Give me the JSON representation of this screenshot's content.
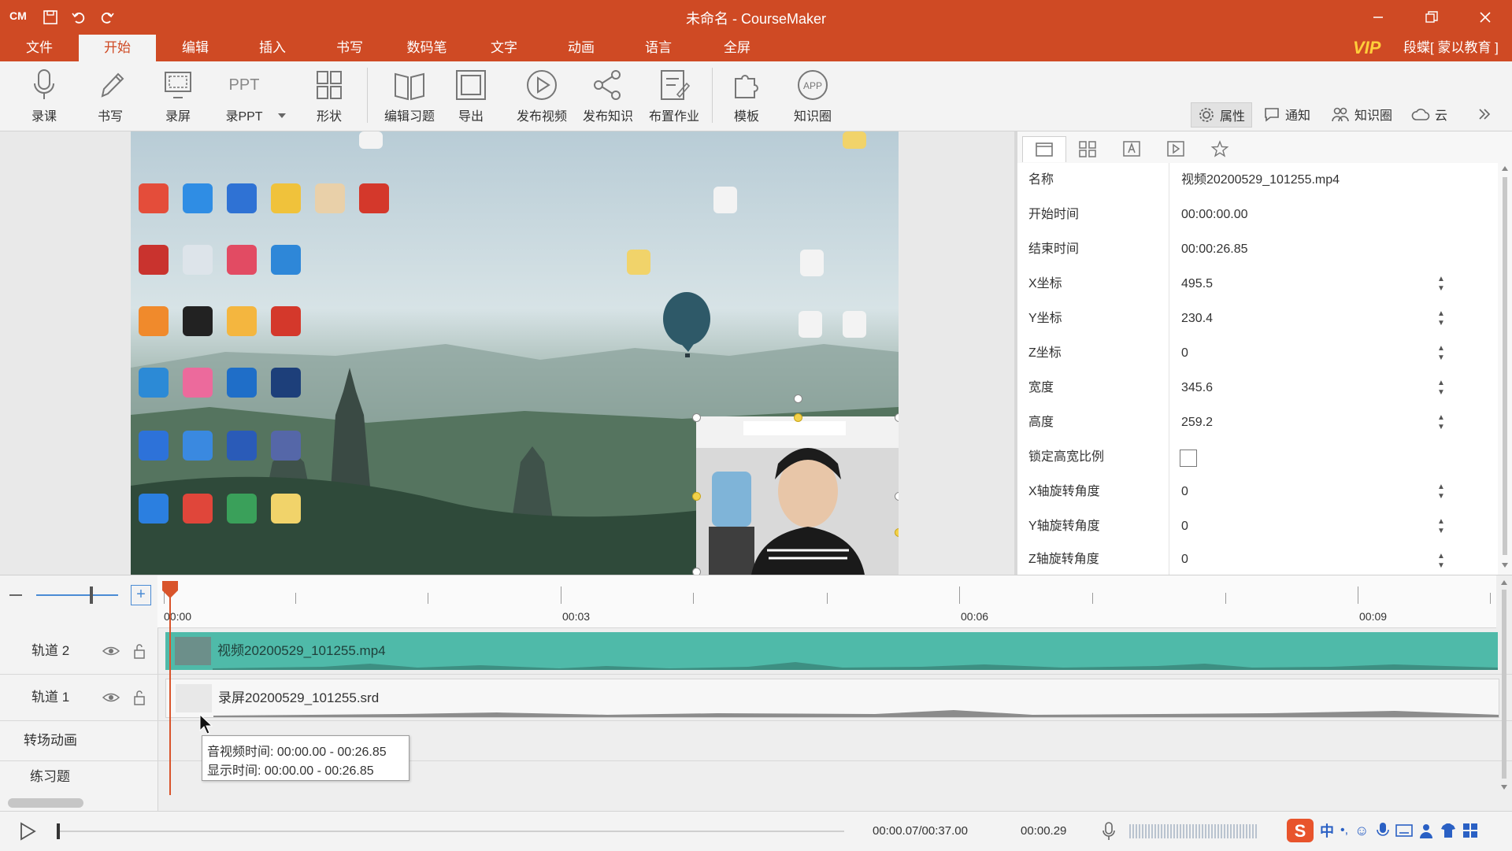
{
  "app": {
    "title": "未命名 - CourseMaker",
    "logo": "CM"
  },
  "quick_access": [
    "save-icon",
    "undo-icon",
    "redo-icon"
  ],
  "window_controls": [
    "minimize-icon",
    "restore-icon",
    "close-icon"
  ],
  "menu": {
    "items": [
      "文件",
      "开始",
      "编辑",
      "插入",
      "书写",
      "数码笔",
      "文字",
      "动画",
      "语言",
      "全屏"
    ],
    "active": "开始",
    "vip": "VIP",
    "user": "段蝶[ 蒙以教育 ]"
  },
  "ribbon": {
    "buttons": [
      {
        "label": "录课",
        "icon": "microphone-icon"
      },
      {
        "label": "书写",
        "icon": "pencil-icon"
      },
      {
        "label": "录屏",
        "icon": "screen-record-icon"
      },
      {
        "label": "录PPT",
        "icon": "ppt-icon",
        "icon_text": "PPT"
      },
      {
        "label": "形状",
        "icon": "shapes-icon"
      },
      {
        "label": "编辑习题",
        "icon": "book-icon"
      },
      {
        "label": "导出",
        "icon": "export-icon"
      },
      {
        "label": "发布视频",
        "icon": "play-circle-icon"
      },
      {
        "label": "发布知识",
        "icon": "share-icon"
      },
      {
        "label": "布置作业",
        "icon": "assignment-icon"
      },
      {
        "label": "模板",
        "icon": "puzzle-icon"
      },
      {
        "label": "知识圈",
        "icon": "app-icon",
        "icon_text": "APP"
      }
    ],
    "right_tools": [
      {
        "label": "属性",
        "icon": "gear-icon"
      },
      {
        "label": "通知",
        "icon": "chat-icon"
      },
      {
        "label": "知识圈",
        "icon": "people-icon"
      },
      {
        "label": "云",
        "icon": "cloud-icon"
      }
    ]
  },
  "properties": {
    "tabs": [
      "window-tab-icon",
      "grid-tab-icon",
      "text-tab-icon",
      "media-tab-icon",
      "star-tab-icon"
    ],
    "rows": [
      {
        "key": "名称",
        "value": "视频20200529_101255.mp4",
        "type": "text"
      },
      {
        "key": "开始时间",
        "value": "00:00:00.00",
        "type": "text"
      },
      {
        "key": "结束时间",
        "value": "00:00:26.85",
        "type": "text"
      },
      {
        "key": "X坐标",
        "value": "495.5",
        "type": "spin"
      },
      {
        "key": "Y坐标",
        "value": "230.4",
        "type": "spin"
      },
      {
        "key": "Z坐标",
        "value": "0",
        "type": "spin"
      },
      {
        "key": "宽度",
        "value": "345.6",
        "type": "spin"
      },
      {
        "key": "高度",
        "value": "259.2",
        "type": "spin"
      },
      {
        "key": "锁定高宽比例",
        "value": "",
        "type": "checkbox",
        "checked": false
      },
      {
        "key": "X轴旋转角度",
        "value": "0",
        "type": "spin"
      },
      {
        "key": "Y轴旋转角度",
        "value": "0",
        "type": "spin"
      },
      {
        "key": "Z轴旋转角度",
        "value": "0",
        "type": "spin"
      }
    ]
  },
  "timeline": {
    "ruler_labels": [
      "00:00",
      "00:03",
      "00:06",
      "00:09"
    ],
    "tracks": [
      {
        "name": "轨道 2",
        "clip": "视频20200529_101255.mp4",
        "color": "#4fbaa9"
      },
      {
        "name": "轨道 1",
        "clip": "录屏20200529_101255.srd",
        "color": "#f5f5f5"
      }
    ],
    "extra_rows": [
      "转场动画",
      "练习题"
    ],
    "tooltip": {
      "line1": "音视频时间: 00:00.00 - 00:26.85",
      "line2": "显示时间: 00:00.00 - 00:26.85"
    }
  },
  "status": {
    "position": "00:00.07/00:37.00",
    "level": "00:00.29"
  },
  "ime": {
    "label": "中"
  },
  "colors": {
    "brand": "#cf4a24",
    "teal": "#4fbaa9",
    "playhead": "#d9542b"
  }
}
